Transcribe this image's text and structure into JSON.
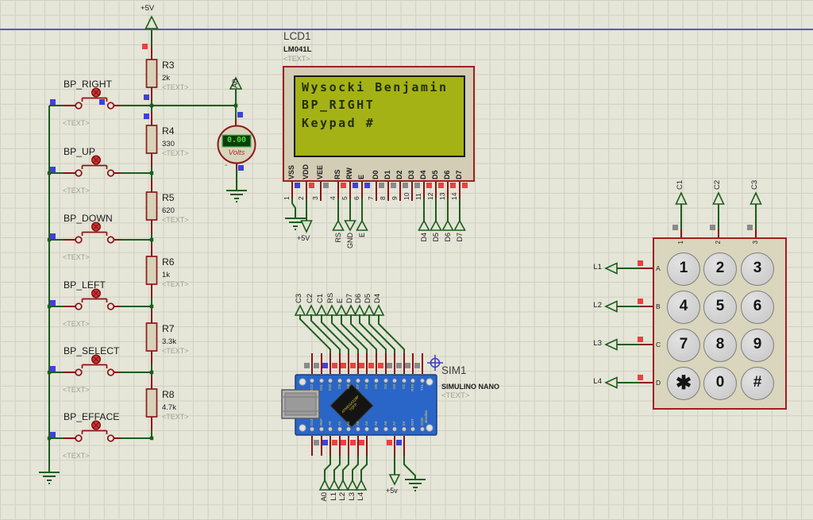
{
  "placeholder": "<TEXT>",
  "power": {
    "rail_top": "+5V",
    "lcd_vdd": "+5V",
    "nano_5v": "+5v"
  },
  "terminals": {
    "a0_probe": "A0",
    "lcd": [
      "RS",
      "GND",
      "E",
      "D4",
      "D5",
      "D6",
      "D7"
    ],
    "nano_top": [
      "C3",
      "C2",
      "C1",
      "RS",
      "E",
      "D7",
      "D6",
      "D5",
      "D4"
    ],
    "nano_bottom": [
      "A0",
      "L1",
      "L2",
      "L3",
      "L4"
    ],
    "keypad_top": [
      "C1",
      "C2",
      "C3"
    ],
    "keypad_left": [
      "L1",
      "L2",
      "L3",
      "L4"
    ]
  },
  "push_buttons": [
    "BP_RIGHT",
    "BP_UP",
    "BP_DOWN",
    "BP_LEFT",
    "BP_SELECT",
    "BP_EFFACE"
  ],
  "resistors": [
    {
      "ref": "R3",
      "value": "2k"
    },
    {
      "ref": "R4",
      "value": "330"
    },
    {
      "ref": "R5",
      "value": "620"
    },
    {
      "ref": "R6",
      "value": "1k"
    },
    {
      "ref": "R7",
      "value": "3.3k"
    },
    {
      "ref": "R8",
      "value": "4.7k"
    }
  ],
  "voltmeter": {
    "reading": "0.00",
    "unit": "Volts",
    "minus": "-"
  },
  "lcd": {
    "ref": "LCD1",
    "part": "LM041L",
    "screen_lines": [
      "Wysocki Benjamin",
      "BP_RIGHT",
      "Keypad #",
      ""
    ],
    "pin_names": [
      "VSS",
      "VDD",
      "VEE",
      "RS",
      "RW",
      "E",
      "D0",
      "D1",
      "D2",
      "D3",
      "D4",
      "D5",
      "D6",
      "D7"
    ],
    "pin_numbers": [
      "1",
      "2",
      "3",
      "4",
      "5",
      "6",
      "7",
      "8",
      "9",
      "10",
      "11",
      "12",
      "13",
      "14"
    ]
  },
  "nano": {
    "ref": "SIM1",
    "part": "SIMULINO NANO",
    "chip_line1": "ATMEGA328P",
    "chip_line2": "TQFP",
    "side_text": "simulino",
    "top_pin_labels": [
      "D12",
      "D11",
      "D10",
      "D9",
      "D8",
      "D7",
      "D6",
      "D5",
      "D4",
      "D3",
      "D2",
      "RX0",
      "TX1"
    ],
    "bottom_pin_labels": [
      "D13",
      "REF",
      "A0",
      "A1",
      "A2",
      "A3",
      "A4",
      "A5",
      "A6",
      "A7",
      "5V",
      "RST",
      "GND"
    ]
  },
  "keypad": {
    "keys": [
      "1",
      "2",
      "3",
      "4",
      "5",
      "6",
      "7",
      "8",
      "9",
      "✱",
      "0",
      "#"
    ],
    "row_labels": [
      "A",
      "B",
      "C",
      "D"
    ],
    "col_numbers": [
      "1",
      "2",
      "3"
    ]
  },
  "colors": {
    "wire": "#1b5e1b",
    "pin": "#8b1111",
    "component_border": "#a02020",
    "component_fill": "#d8d2ba",
    "indicator_blue": "#4040dd",
    "indicator_red": "#ee3f3f",
    "indicator_gray": "#8a8a8a",
    "lcd_screen": "#a4b216",
    "nano_board": "#2a66c8"
  }
}
